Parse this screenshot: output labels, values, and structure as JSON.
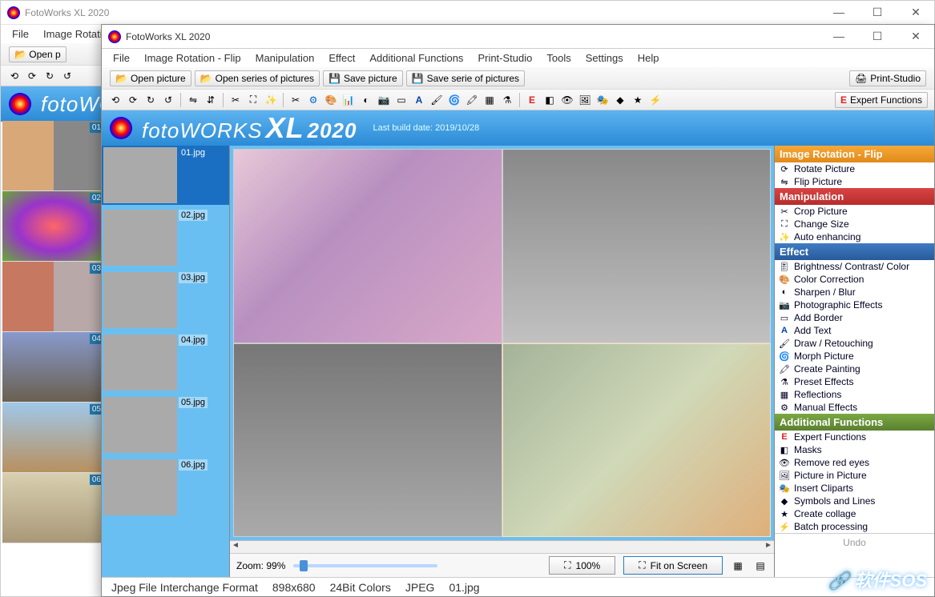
{
  "app_title": "FotoWorks XL 2020",
  "menus": [
    "File",
    "Image Rotation - Flip",
    "Manipulation",
    "Effect",
    "Additional Functions",
    "Print-Studio",
    "Tools",
    "Settings",
    "Help"
  ],
  "toolbar": {
    "open_picture": "Open picture",
    "open_series": "Open series of pictures",
    "save_picture": "Save picture",
    "save_series": "Save serie of pictures",
    "print_studio": "Print-Studio",
    "expert_functions": "Expert Functions"
  },
  "brand": {
    "prefix": "foto",
    "bold": "WORKS",
    "xl": "XL",
    "year": "2020",
    "build": "Last build date: 2019/10/28"
  },
  "thumbs": [
    "01.jpg",
    "02.jpg",
    "03.jpg",
    "04.jpg",
    "05.jpg",
    "06.jpg"
  ],
  "back_thumbs": [
    "01",
    "02",
    "03",
    "04",
    "05",
    "06"
  ],
  "zoom": {
    "label": "Zoom: 99%",
    "b100": "100%",
    "fit": "Fit on Screen"
  },
  "status": {
    "format": "Jpeg File Interchange Format",
    "dims": "898x680",
    "depth": "24Bit Colors",
    "type": "JPEG",
    "file": "01.jpg"
  },
  "panel": {
    "rot_head": "Image Rotation - Flip",
    "rot": [
      "Rotate Picture",
      "Flip Picture"
    ],
    "man_head": "Manipulation",
    "man": [
      "Crop Picture",
      "Change Size",
      "Auto enhancing"
    ],
    "eff_head": "Effect",
    "eff": [
      "Brightness/ Contrast/ Color",
      "Color Correction",
      "Sharpen / Blur",
      "Photographic Effects",
      "Add Border",
      "Add Text",
      "Draw / Retouching",
      "Morph Picture",
      "Create Painting",
      "Preset Effects",
      "Reflections",
      "Manual Effects"
    ],
    "add_head": "Additional Functions",
    "add": [
      "Expert Functions",
      "Masks",
      "Remove red eyes",
      "Picture in Picture",
      "Insert Cliparts",
      "Symbols and Lines",
      "Create collage",
      "Batch processing"
    ],
    "undo": "Undo"
  },
  "watermark": "软件SOS"
}
